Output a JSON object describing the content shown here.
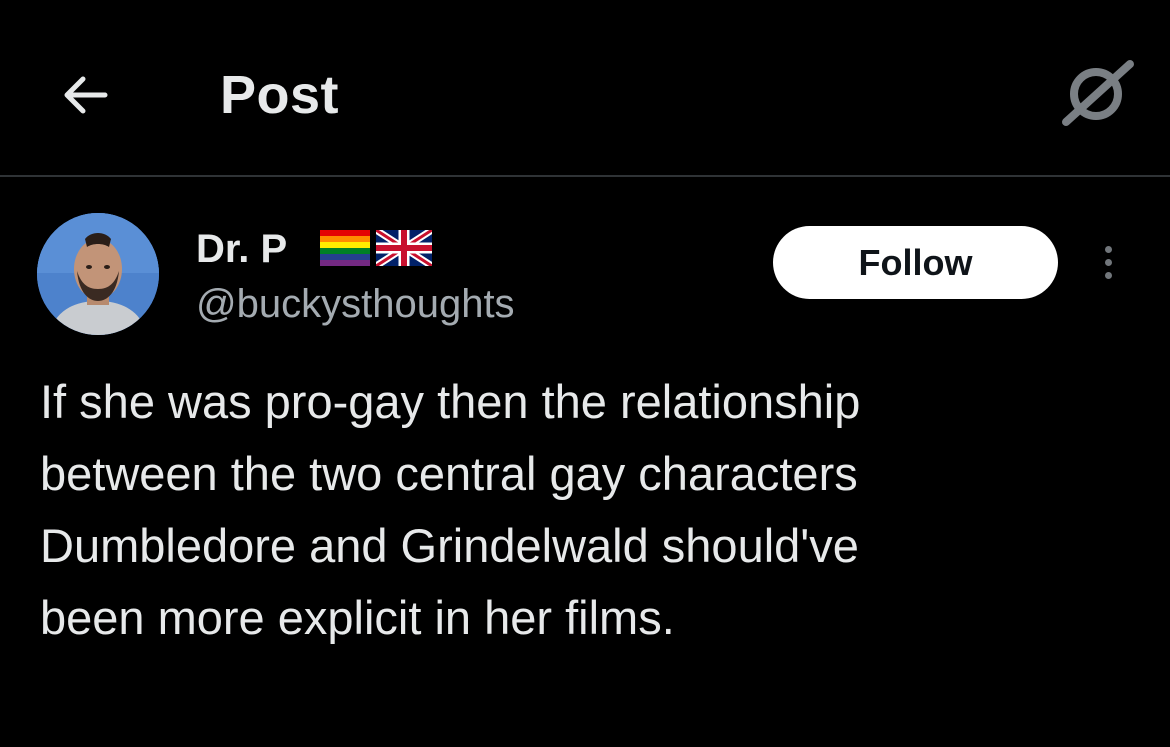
{
  "header": {
    "title": "Post",
    "back_icon": "arrow-left-icon",
    "right_icon": "sparkle-slash-icon"
  },
  "post": {
    "author": {
      "display_name": "Dr. P",
      "flags": [
        "rainbow-pride-flag-icon",
        "uk-flag-icon"
      ],
      "handle": "@buckysthoughts",
      "avatar": "avatar"
    },
    "follow_label": "Follow",
    "more_icon": "more-vertical-icon",
    "text": "If she was pro-gay then the relationship\nbetween the two central gay characters\nDumbledore and Grindelwald should've\nbeen more explicit in her films."
  },
  "colors": {
    "background": "#000000",
    "text": "#e7e9ea",
    "secondary_text": "#a4abb1",
    "divider": "#2f3336",
    "follow_bg": "#ffffff",
    "follow_text": "#0f1419"
  }
}
